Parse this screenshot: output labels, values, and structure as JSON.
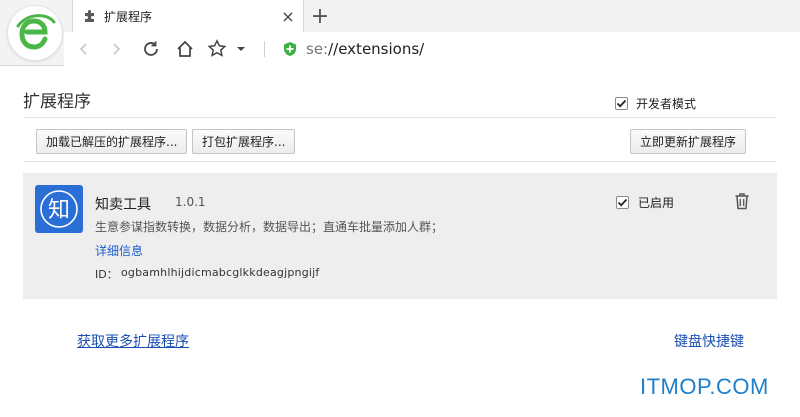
{
  "browser": {
    "tab": {
      "title": "扩展程序",
      "close": "×"
    },
    "new_tab": "+",
    "address": {
      "protocol": "se:",
      "path": "//extensions/"
    }
  },
  "page": {
    "title": "扩展程序",
    "developer_mode": {
      "label": "开发者模式",
      "checked": true
    },
    "buttons": {
      "load_unpacked": "加载已解压的扩展程序...",
      "pack": "打包扩展程序...",
      "update_now": "立即更新扩展程序"
    }
  },
  "extension": {
    "name": "知卖工具",
    "version": "1.0.1",
    "description": "生意参谋指数转换，数据分析，数据导出；直通车批量添加人群；",
    "details_link": "详细信息",
    "id_label": "ID：",
    "id_value": "ogbamhlhijdicmabcglkkdeagjpngijf",
    "enabled_label": "已启用",
    "enabled": true,
    "icon_glyph": "知",
    "icon_color": "#2a6fd6"
  },
  "footer": {
    "more_extensions": "获取更多扩展程序",
    "keyboard_shortcuts": "键盘快捷键"
  },
  "watermark": "ITMOP.COM",
  "colors": {
    "link": "#1a4fb3",
    "accent_green": "#3cb043",
    "watermark": "#1f7fc8"
  }
}
